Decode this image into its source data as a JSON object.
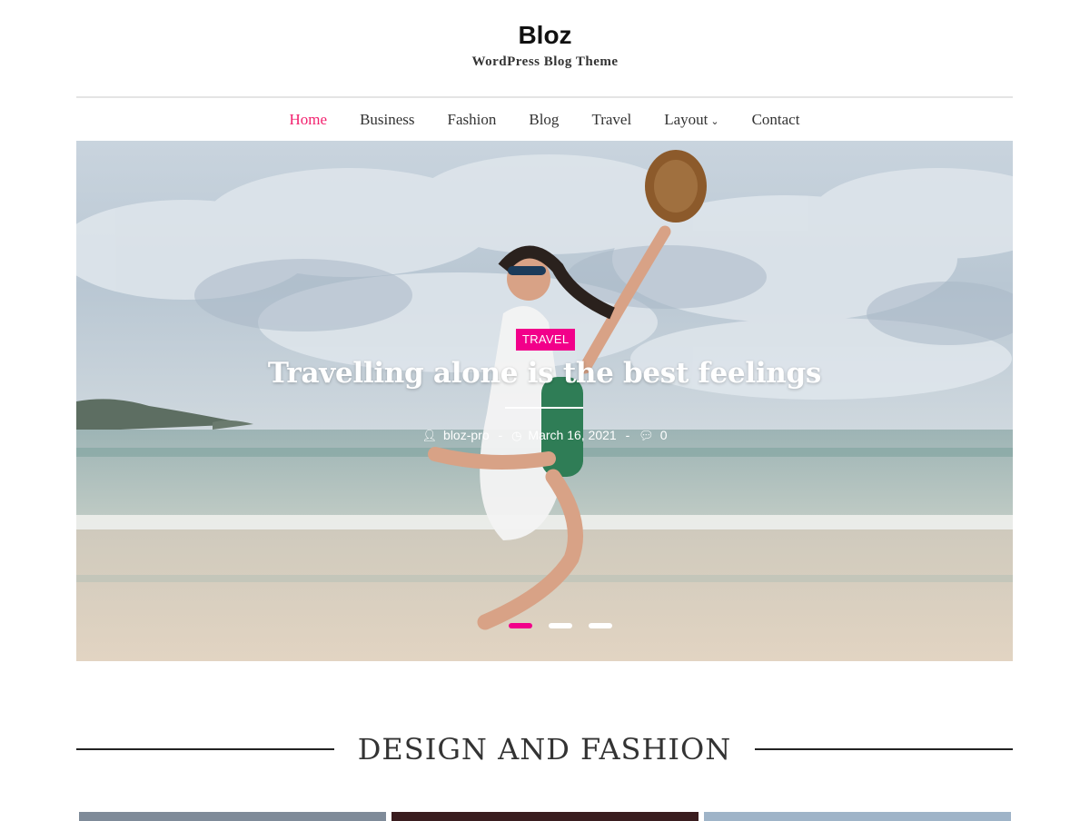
{
  "site": {
    "title": "Bloz",
    "tagline": "WordPress Blog Theme"
  },
  "nav": {
    "items": [
      {
        "label": "Home",
        "active": true
      },
      {
        "label": "Business",
        "active": false
      },
      {
        "label": "Fashion",
        "active": false
      },
      {
        "label": "Blog",
        "active": false
      },
      {
        "label": "Travel",
        "active": false
      },
      {
        "label": "Layout",
        "active": false,
        "has_dropdown": true
      },
      {
        "label": "Contact",
        "active": false
      }
    ]
  },
  "hero": {
    "category": "TRAVEL",
    "title": "Travelling alone is the best feelings",
    "author": "bloz-pro",
    "separator": "-",
    "date": "March 16, 2021",
    "comments": "0",
    "slides_total": 3,
    "active_slide": 1
  },
  "section": {
    "heading": "DESIGN AND FASHION"
  },
  "colors": {
    "accent": "#f2008a",
    "nav_active": "#f2216e"
  }
}
